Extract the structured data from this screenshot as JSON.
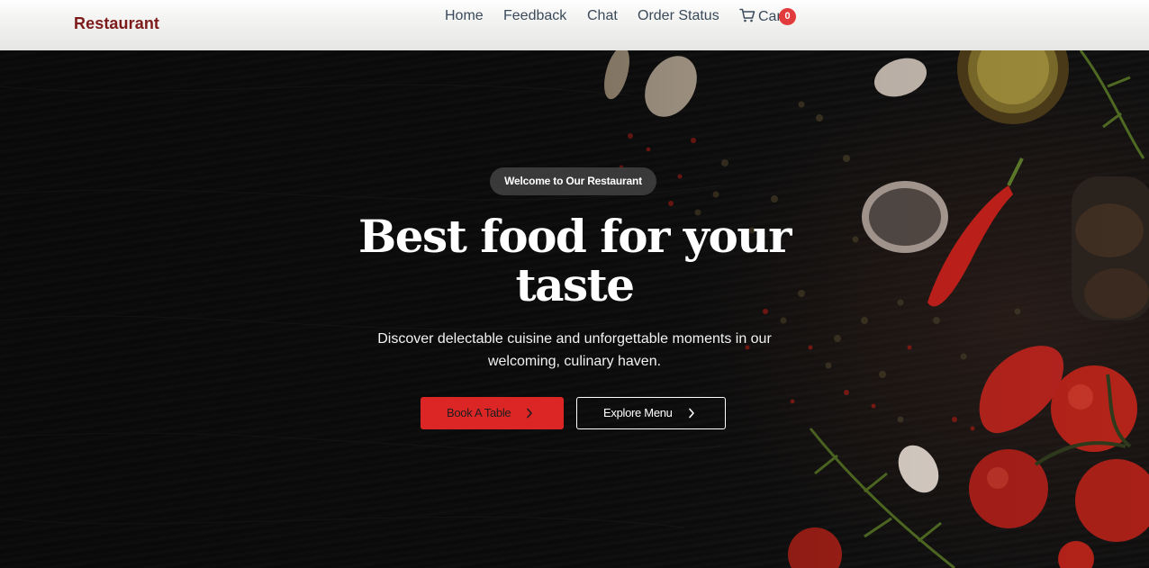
{
  "nav": {
    "brand": "Restaurant",
    "links": [
      "Home",
      "Feedback",
      "Chat",
      "Order Status"
    ],
    "cart_label": "Cart",
    "cart_count": "0"
  },
  "hero": {
    "badge": "Welcome to Our Restaurant",
    "title": "Best food for your taste",
    "subtitle": "Discover delectable cuisine and unforgettable moments in our welcoming, culinary haven.",
    "primary_button": "Book A Table",
    "secondary_button": "Explore Menu"
  },
  "colors": {
    "brand": "#7d1a1a",
    "primary_button": "#dc2626",
    "badge": "#e23b3b",
    "hero_bg": "#0f0f0f"
  },
  "icons": [
    "cart-icon",
    "chevron-right-icon"
  ]
}
